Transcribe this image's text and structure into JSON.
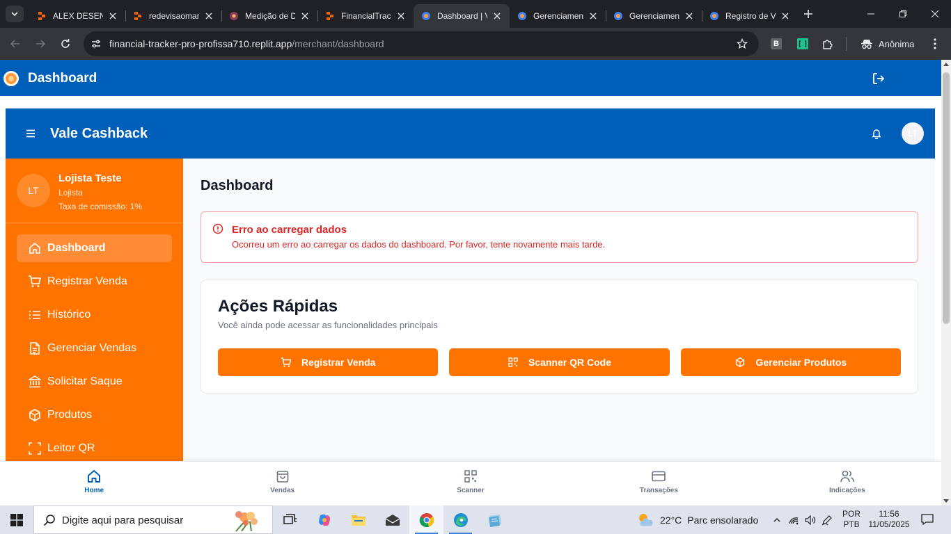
{
  "browser": {
    "tabs": [
      {
        "title": "ALEX DESENVOLVEDOR",
        "icon": "replit-icon",
        "active": false
      },
      {
        "title": "redevisaomarketing",
        "icon": "replit-icon",
        "active": false
      },
      {
        "title": "Medição de Desempenho",
        "icon": "app-icon",
        "active": false
      },
      {
        "title": "FinancialTracker",
        "icon": "replit-icon",
        "active": false
      },
      {
        "title": "Dashboard | Vale Cashback",
        "icon": "vale-icon",
        "active": true
      },
      {
        "title": "Gerenciamento",
        "icon": "vale-icon",
        "active": false
      },
      {
        "title": "Gerenciamento",
        "icon": "vale-icon",
        "active": false
      },
      {
        "title": "Registro de Vendas",
        "icon": "vale-icon",
        "active": false
      }
    ],
    "url_host": "financial-tracker-pro-profissa710.replit.app",
    "url_path": "/merchant/dashboard",
    "ext_b_label": "B",
    "profile_label": "Anônima"
  },
  "app": {
    "header_title": "Dashboard",
    "brand": "Vale Cashback",
    "top_avatar_initials": "LT"
  },
  "user": {
    "initials": "LT",
    "name": "Lojista Teste",
    "role": "Lojista",
    "fee": "Taxa de comissão: 1%"
  },
  "sidebar": {
    "items": [
      {
        "label": "Dashboard",
        "icon": "home-icon",
        "active": true
      },
      {
        "label": "Registrar Venda",
        "icon": "cart-icon",
        "active": false
      },
      {
        "label": "Histórico",
        "icon": "list-icon",
        "active": false
      },
      {
        "label": "Gerenciar Vendas",
        "icon": "document-icon",
        "active": false
      },
      {
        "label": "Solicitar Saque",
        "icon": "bank-icon",
        "active": false
      },
      {
        "label": "Produtos",
        "icon": "box-icon",
        "active": false
      },
      {
        "label": "Leitor QR",
        "icon": "scan-icon",
        "active": false
      }
    ]
  },
  "main": {
    "heading": "Dashboard",
    "alert": {
      "title": "Erro ao carregar dados",
      "message": "Ocorreu um erro ao carregar os dados do dashboard. Por favor, tente novamente mais tarde."
    },
    "quick_actions": {
      "title": "Ações Rápidas",
      "subtitle": "Você ainda pode acessar as funcionalidades principais",
      "buttons": [
        {
          "label": "Registrar Venda",
          "icon": "cart-icon"
        },
        {
          "label": "Scanner QR Code",
          "icon": "qr-icon"
        },
        {
          "label": "Gerenciar Produtos",
          "icon": "box-icon"
        }
      ]
    }
  },
  "bottom_nav": [
    {
      "label": "Home",
      "icon": "home-icon",
      "active": true
    },
    {
      "label": "Vendas",
      "icon": "bag-icon",
      "active": false
    },
    {
      "label": "Scanner",
      "icon": "qr-icon",
      "active": false
    },
    {
      "label": "Transações",
      "icon": "card-icon",
      "active": false
    },
    {
      "label": "Indicações",
      "icon": "users-icon",
      "active": false
    }
  ],
  "taskbar": {
    "search_placeholder": "Digite aqui para pesquisar",
    "temperature": "22°C",
    "weather": "Parc ensolarado",
    "lang_top": "POR",
    "lang_bottom": "PTB",
    "time": "11:56",
    "date": "11/05/2025"
  },
  "colors": {
    "brand_blue": "#005fb8",
    "brand_orange": "#ff7300",
    "error_red": "#dc2626"
  }
}
